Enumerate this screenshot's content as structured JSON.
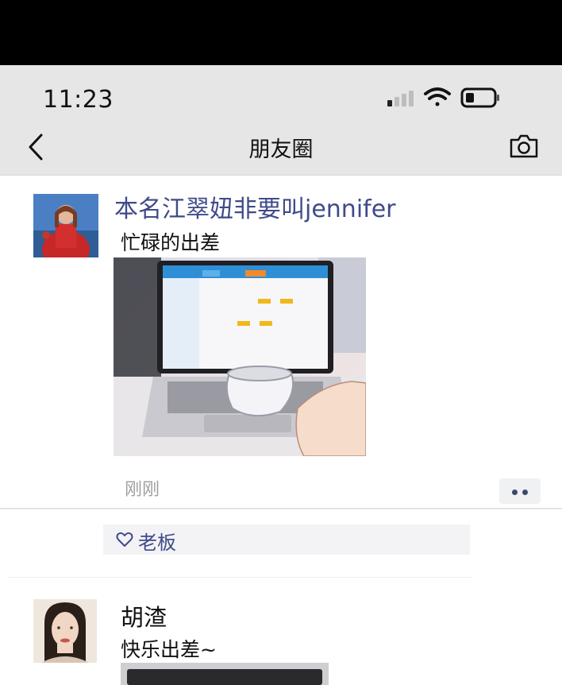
{
  "status": {
    "time": "11:23"
  },
  "nav": {
    "title": "朋友圈"
  },
  "posts": [
    {
      "author": "本名江翠妞非要叫jennifer",
      "text": "忙碌的出差",
      "timestamp": "刚刚",
      "likes": [
        "老板"
      ]
    },
    {
      "author": "胡渣",
      "text": "快乐出差~"
    }
  ],
  "icons": [
    "back-chevron-icon",
    "camera-icon",
    "signal-icon",
    "wifi-icon",
    "battery-icon",
    "heart-icon",
    "more-icon"
  ]
}
